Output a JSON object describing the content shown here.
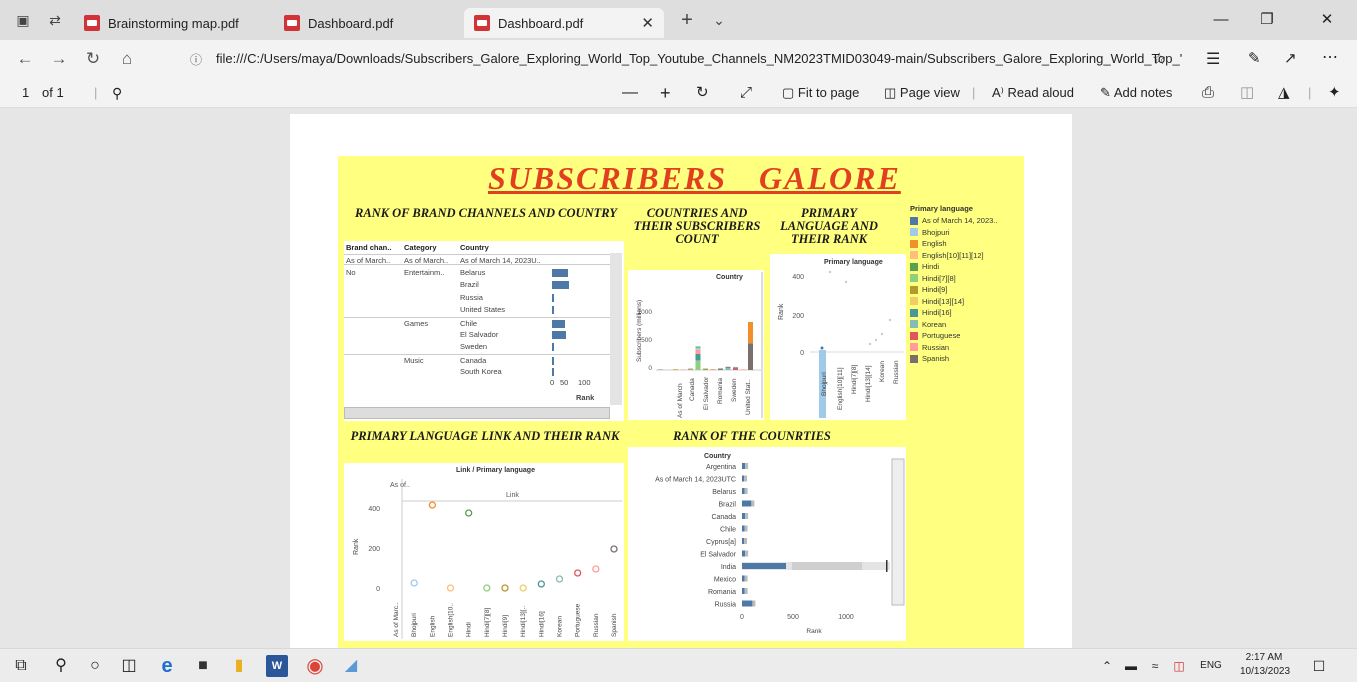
{
  "browser": {
    "tabs": [
      {
        "label": "Brainstorming map.pdf"
      },
      {
        "label": "Dashboard.pdf"
      },
      {
        "label": "Dashboard.pdf",
        "active": true
      }
    ],
    "url": "file:///C:/Users/maya/Downloads/Subscribers_Galore_Exploring_World_Top_Youtube_Channels_NM2023TMID03049-main/Subscribers_Galore_Exploring_World_Top_'"
  },
  "pdf_toolbar": {
    "page_number": "1",
    "page_total": "of 1",
    "fit_to_page": "Fit to page",
    "page_view": "Page view",
    "read_aloud": "Read aloud",
    "add_notes": "Add notes"
  },
  "dashboard": {
    "title": "SUBSCRIBERS GALORE",
    "brand_section": {
      "heading": "RANK OF BRAND CHANNELS AND COUNTRY",
      "columns": [
        "Brand chan..",
        "Category",
        "Country"
      ],
      "header_row": [
        "As of March..",
        "As of March..",
        "As of March 14, 2023U.."
      ],
      "rows": [
        {
          "brand": "No",
          "category": "Entertainm..",
          "country": "Belarus",
          "rank": 90
        },
        {
          "brand": "",
          "category": "",
          "country": "Brazil",
          "rank": 95
        },
        {
          "brand": "",
          "category": "",
          "country": "Russia",
          "rank": 2
        },
        {
          "brand": "",
          "category": "",
          "country": "United States",
          "rank": 6
        },
        {
          "brand": "",
          "category": "Games",
          "country": "Chile",
          "rank": 70
        },
        {
          "brand": "",
          "category": "",
          "country": "El Salvador",
          "rank": 80
        },
        {
          "brand": "",
          "category": "",
          "country": "Sweden",
          "rank": 3
        },
        {
          "brand": "",
          "category": "Music",
          "country": "Canada",
          "rank": 12
        },
        {
          "brand": "",
          "category": "",
          "country": "South Korea",
          "rank": 10
        }
      ],
      "axis_ticks": [
        "0",
        "50",
        "100"
      ],
      "axis_label": "Rank"
    },
    "countries_section": {
      "heading": "COUNTRIES AND THEIR SUBSCRIBERS COUNT",
      "chart_title": "Country",
      "ylabel": "Subscribers (millions)",
      "yticks": [
        "0",
        "500",
        "1000"
      ],
      "xlabels": [
        "As of March",
        "Canada",
        "El Salvador",
        "Romania",
        "Sweden",
        "United Stat.."
      ]
    },
    "language_rank_section": {
      "heading": "PRIMARY LANGUAGE AND THEIR RANK",
      "chart_title": "Primary language",
      "ylabel": "Rank",
      "yticks": [
        "0",
        "200",
        "400"
      ],
      "xlabels": [
        "Bhojpuri",
        "English[10][11]",
        "Hindi[7][8]",
        "Hindi[13][14]",
        "Korean",
        "Russian"
      ]
    },
    "legend": {
      "title": "Primary language",
      "items": [
        {
          "label": "As of March 14, 2023..",
          "color": "#4e79a7"
        },
        {
          "label": "Bhojpuri",
          "color": "#a0cbe8"
        },
        {
          "label": "English",
          "color": "#f28e2b"
        },
        {
          "label": "English[10][11][12]",
          "color": "#ffbe7d"
        },
        {
          "label": "Hindi",
          "color": "#59a14f"
        },
        {
          "label": "Hindi[7][8]",
          "color": "#8cd17d"
        },
        {
          "label": "Hindi[9]",
          "color": "#b6992d"
        },
        {
          "label": "Hindi[13][14]",
          "color": "#f1ce63"
        },
        {
          "label": "Hindi[16]",
          "color": "#499894"
        },
        {
          "label": "Korean",
          "color": "#86bcb6"
        },
        {
          "label": "Portuguese",
          "color": "#e15759"
        },
        {
          "label": "Russian",
          "color": "#ff9d9a"
        },
        {
          "label": "Spanish",
          "color": "#79706e"
        }
      ]
    },
    "link_section": {
      "heading": "PRIMARY LANGUAGE LINK AND THEIR RANK",
      "chart_title": "Link / Primary language",
      "corner_label": "As of..",
      "series_label": "Link",
      "ylabel": "Rank",
      "yticks": [
        "0",
        "200",
        "400"
      ]
    },
    "rank_countries_section": {
      "heading": "RANK OF THE COUNRTIES",
      "chart_title": "Country",
      "xticks": [
        "0",
        "500",
        "1000"
      ],
      "xlabel": "Rank"
    }
  },
  "chart_data": [
    {
      "type": "scatter",
      "title": "Link / Primary language",
      "ylabel": "Rank",
      "ylim": [
        0,
        480
      ],
      "categories": [
        "As of Marc..",
        "Bhojpuri",
        "English",
        "English[10..",
        "Hindi",
        "Hindi[7][8]",
        "Hindi[9]",
        "Hindi[13][..",
        "Hindi[16]",
        "Korean",
        "Portuguese",
        "Russian",
        "Spanish"
      ],
      "values": [
        null,
        30,
        420,
        5,
        380,
        5,
        5,
        5,
        25,
        50,
        80,
        100,
        200
      ],
      "colors": [
        "#4e79a7",
        "#a0cbe8",
        "#f28e2b",
        "#ffbe7d",
        "#59a14f",
        "#8cd17d",
        "#b6992d",
        "#f1ce63",
        "#499894",
        "#86bcb6",
        "#e15759",
        "#ff9d9a",
        "#79706e"
      ]
    },
    {
      "type": "bar",
      "title": "Country",
      "orientation": "horizontal",
      "xlabel": "Rank",
      "xlim": [
        0,
        1300
      ],
      "categories": [
        "Argentina",
        "As of March 14, 2023UTC",
        "Belarus",
        "Brazil",
        "Canada",
        "Chile",
        "Cyprus[a]",
        "El Salvador",
        "India",
        "Mexico",
        "Romania",
        "Russia"
      ],
      "values": [
        30,
        10,
        25,
        90,
        30,
        25,
        15,
        30,
        1300,
        25,
        25,
        100
      ]
    }
  ]
}
